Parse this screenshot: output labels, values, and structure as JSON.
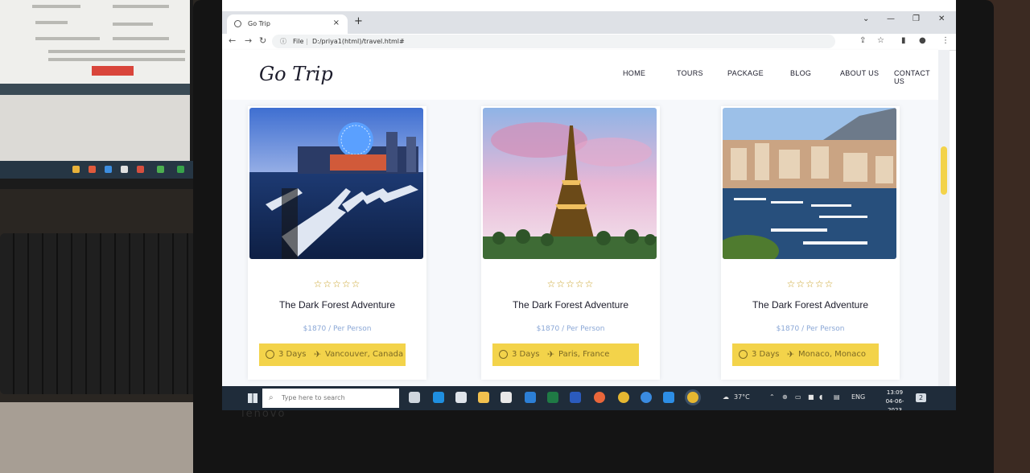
{
  "browser": {
    "tab_title": "Go Trip",
    "new_tab": "+",
    "url_file_label": "File",
    "url_path": "D:/priya1(html)/travel.html#"
  },
  "site": {
    "logo": "Go Trip",
    "nav": [
      "HOME",
      "TOURS",
      "PACKAGE",
      "BLOG",
      "ABOUT US",
      "CONTACT US"
    ]
  },
  "cards": [
    {
      "rating_stars": 5,
      "stars_text": "☆☆☆☆☆",
      "title": "The Dark Forest Adventure",
      "price": "$1870 / Per Person",
      "days": "3 Days",
      "location": "Vancouver, Canada"
    },
    {
      "rating_stars": 5,
      "stars_text": "☆☆☆☆☆",
      "title": "The Dark Forest Adventure",
      "price": "$1870 / Per Person",
      "days": "3 Days",
      "location": "Paris, France"
    },
    {
      "rating_stars": 5,
      "stars_text": "☆☆☆☆☆",
      "title": "The Dark Forest Adventure",
      "price": "$1870 / Per Person",
      "days": "3 Days",
      "location": "Monaco, Monaco"
    }
  ],
  "taskbar": {
    "search_placeholder": "Type here to search",
    "temperature": "37°C",
    "language": "ENG",
    "time": "13:09",
    "date": "04-06-2023",
    "notification_count": "2"
  },
  "colors": {
    "accent_yellow": "#f3d34a",
    "star_color": "#c9a227",
    "price_color": "#8aa7d6",
    "text_dark": "#1c1c2b"
  }
}
